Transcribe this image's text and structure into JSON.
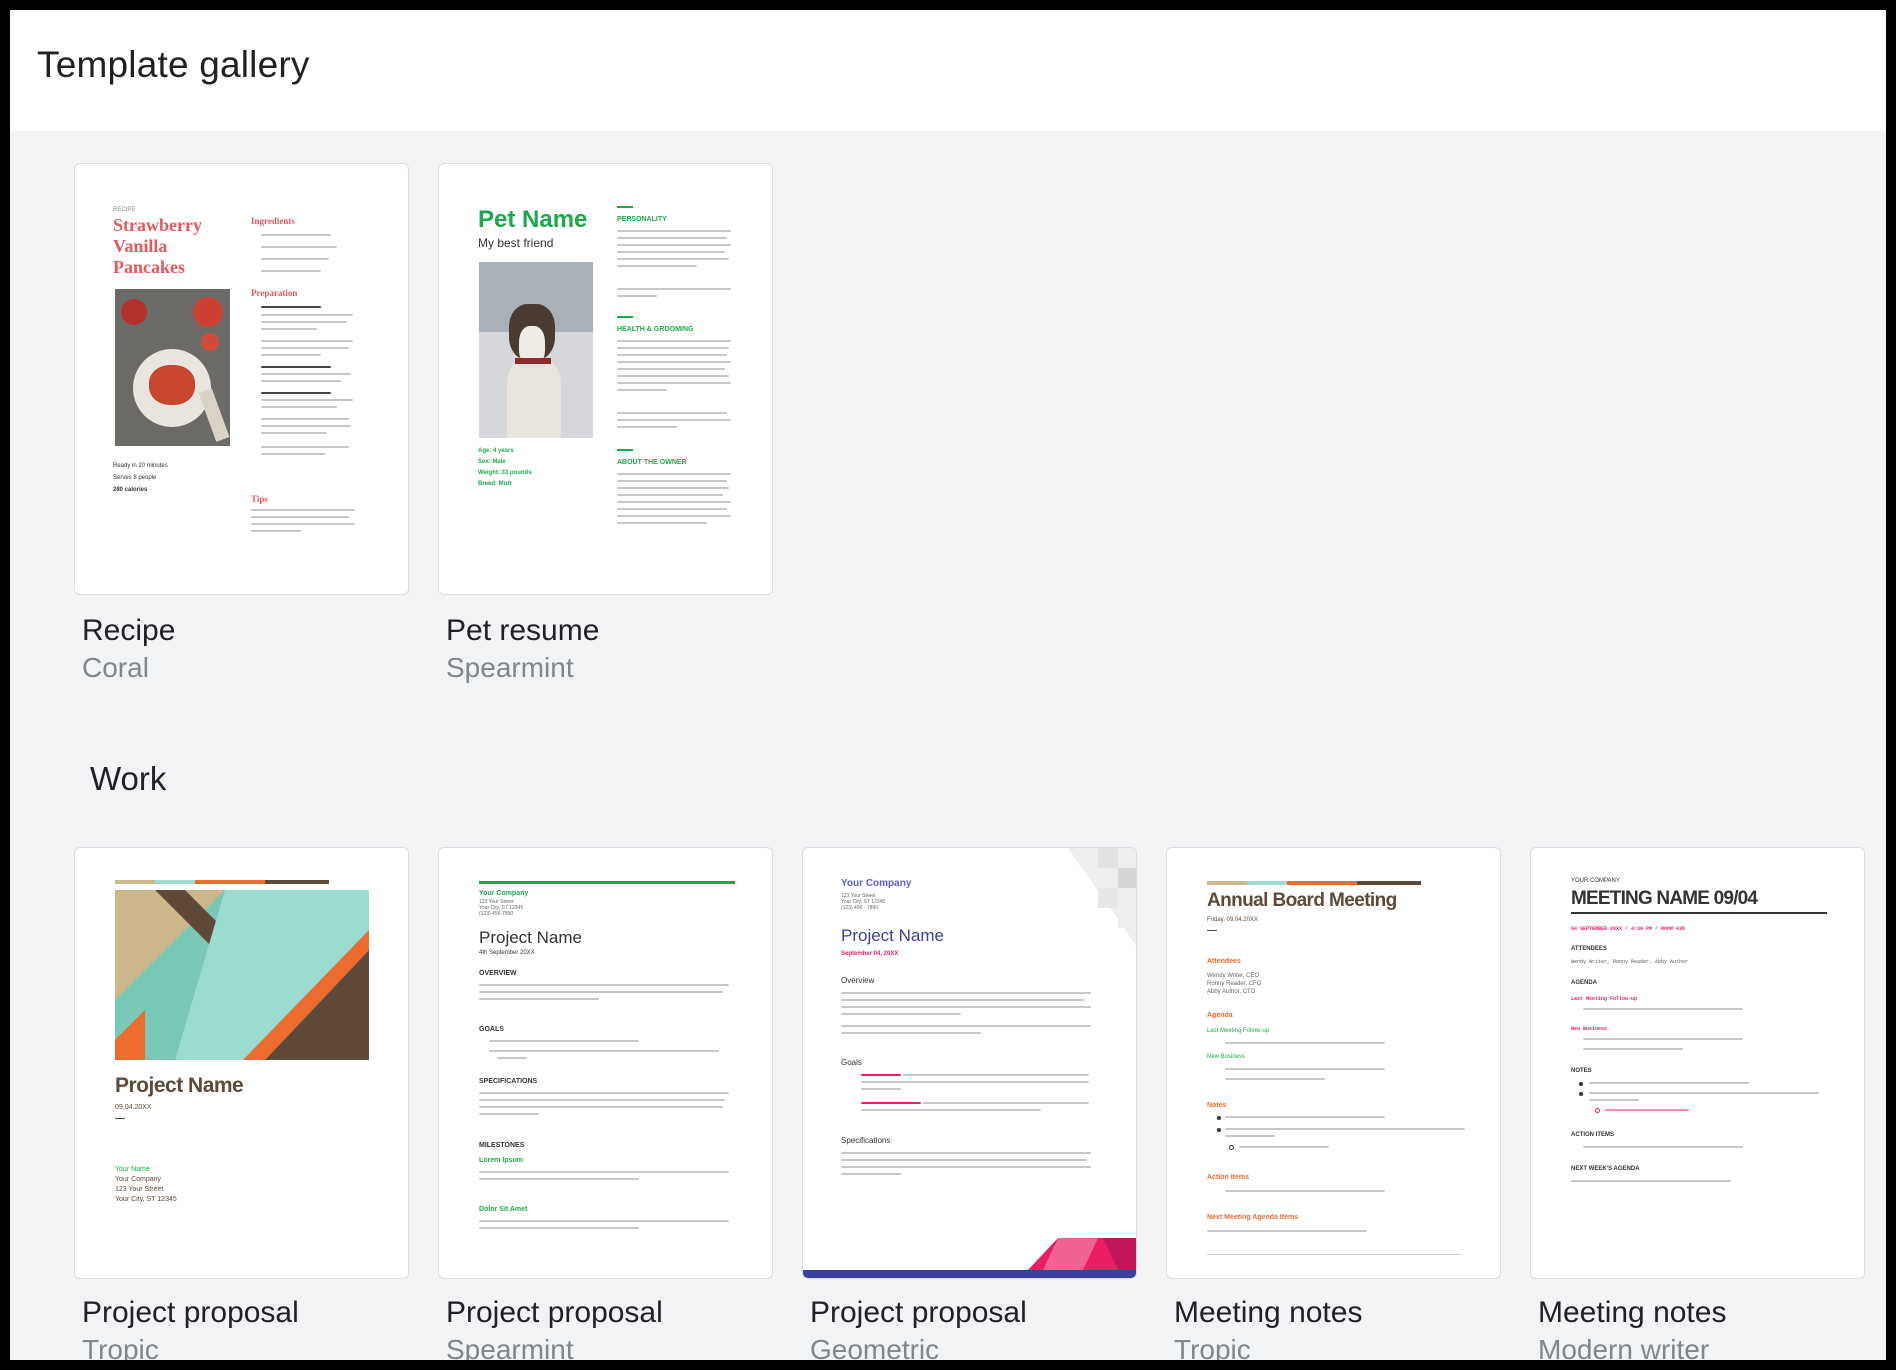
{
  "header": {
    "title": "Template gallery"
  },
  "sections": {
    "work_title": "Work"
  },
  "cards": [
    {
      "title": "Recipe",
      "subtitle": "Coral"
    },
    {
      "title": "Pet resume",
      "subtitle": "Spearmint"
    },
    {
      "title": "Project proposal",
      "subtitle": "Tropic"
    },
    {
      "title": "Project proposal",
      "subtitle": "Spearmint"
    },
    {
      "title": "Project proposal",
      "subtitle": "Geometric"
    },
    {
      "title": "Meeting notes",
      "subtitle": "Tropic"
    },
    {
      "title": "Meeting notes",
      "subtitle": "Modern writer"
    }
  ],
  "previews": {
    "recipe": {
      "kicker": "RECIPE",
      "title_1": "Strawberry",
      "title_2": "Vanilla",
      "title_3": "Pancakes",
      "ingredients": "Ingredients",
      "preparation": "Preparation",
      "tips": "Tips",
      "ready": "Ready in 20 minutes",
      "serves": "Serves 8 people",
      "calories": "280 calories"
    },
    "pet": {
      "name": "Pet Name",
      "tagline": "My best friend",
      "personality": "PERSONALITY",
      "health": "HEALTH & GROOMING",
      "owner": "ABOUT THE OWNER",
      "age": "Age: 4 years",
      "sex": "Sex: Male",
      "weight": "Weight: 33 pounds",
      "breed": "Breed: Mutt"
    },
    "tropic_proposal": {
      "title": "Project Name",
      "date": "09.04.20XX",
      "name": "Your Name",
      "company": "Your Company",
      "street": "123 Your Street",
      "city": "Your City, ST 12345"
    },
    "spearmint_proposal": {
      "company": "Your Company",
      "address": "123 Your Street",
      "city": "Your City, ST 12345",
      "phone": "(123) 456-7890",
      "title": "Project Name",
      "date": "4th September 20XX",
      "overview": "OVERVIEW",
      "goals": "GOALS",
      "specifications": "SPECIFICATIONS",
      "milestones": "MILESTONES",
      "milestone_1": "Lorem Ipsum",
      "milestone_2": "Dolor Sit Amet"
    },
    "geometric_proposal": {
      "company": "Your Company",
      "address": "123 Your Street",
      "city": "Your City, ST 12345",
      "phone": "(123) 456 - 7890",
      "title": "Project Name",
      "date": "September 04, 20XX",
      "overview": "Overview",
      "goals": "Goals",
      "specifications": "Specifications"
    },
    "tropic_notes": {
      "title": "Annual Board Meeting",
      "date": "Friday, 09.04.20XX",
      "attendees": "Attendees",
      "attendee_1": "Wendy Writer, CEO",
      "attendee_2": "Ronny Reader, CFO",
      "attendee_3": "Abby Author, CTO",
      "agenda": "Agenda",
      "followup": "Last Meeting Follow-up",
      "new_business": "New Business",
      "notes": "Notes",
      "action_items": "Action Items",
      "next_agenda": "Next Meeting Agenda Items"
    },
    "modern_notes": {
      "company": "YOUR COMPANY",
      "title": "MEETING NAME 09/04",
      "meta": "04 SEPTEMBER 20XX / 4:30 PM / ROOM 436",
      "attendees": "ATTENDEES",
      "attendee_list": "Wendy Writer, Ronny Reader, Abby Author",
      "agenda": "AGENDA",
      "followup": "Last Meeting Follow-up",
      "new_business": "New Business",
      "notes": "NOTES",
      "action_items": "ACTION ITEMS",
      "next_agenda": "NEXT WEEK'S AGENDA"
    }
  },
  "colors": {
    "coral": "#e8585a",
    "spearmint": "#1ba94c",
    "tropic_brown": "#5f4a3a",
    "tropic_orange": "#ec6b2d",
    "tropic_teal": "#79c8b6",
    "geometric_blue": "#3d3f9e",
    "modern_red": "#e91e63"
  }
}
